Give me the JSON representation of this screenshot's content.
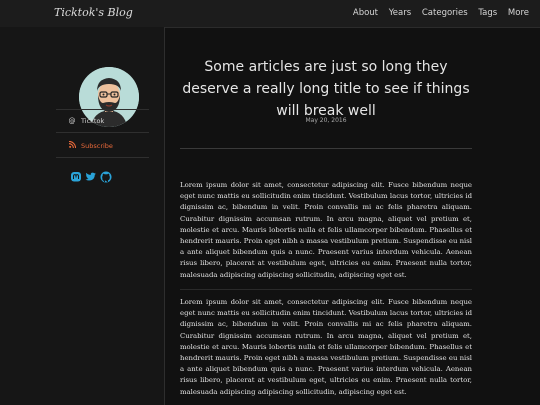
{
  "header": {
    "brand": "Ticktok's Blog",
    "nav": [
      "About",
      "Years",
      "Categories",
      "Tags",
      "More"
    ]
  },
  "sidebar": {
    "avatar_icon": "bearded-man-avatar",
    "ticktok_label": "Ticktok",
    "subscribe_label": "Subscribe",
    "social_icons": [
      "mastodon-icon",
      "twitter-icon",
      "github-icon"
    ],
    "colors": {
      "subscribe": "#e8693a",
      "social": "#2aa3d8"
    }
  },
  "post": {
    "title": "Some articles are just so long they deserve a really long title to see if things will break well",
    "date": "May 20, 2016",
    "paragraphs": [
      "Lorem ipsum dolor sit amet, consectetur adipiscing elit. Fusce bibendum neque eget nunc mattis eu sollicitudin enim tincidunt. Vestibulum lacus tortor, ultricies id dignissim ac, bibendum in velit. Proin convallis mi ac felis pharetra aliquam. Curabitur dignissim accumsan rutrum. In arcu magna, aliquet vel pretium et, molestie et arcu. Mauris lobortis nulla et felis ullamcorper bibendum. Phasellus et hendrerit mauris. Proin eget nibh a massa vestibulum pretium. Suspendisse eu nisl a ante aliquet bibendum quis a nunc. Praesent varius interdum vehicula. Aenean risus libero, placerat at vestibulum eget, ultricies eu enim. Praesent nulla tortor, malesuada adipiscing adipiscing sollicitudin, adipiscing eget est.",
      "Lorem ipsum dolor sit amet, consectetur adipiscing elit. Fusce bibendum neque eget nunc mattis eu sollicitudin enim tincidunt. Vestibulum lacus tortor, ultricies id dignissim ac, bibendum in velit. Proin convallis mi ac felis pharetra aliquam. Curabitur dignissim accumsan rutrum. In arcu magna, aliquet vel pretium et, molestie et arcu. Mauris lobortis nulla et felis ullamcorper bibendum. Phasellus et hendrerit mauris. Proin eget nibh a massa vestibulum pretium. Suspendisse eu nisl a ante aliquet bibendum quis a nunc. Praesent varius interdum vehicula. Aenean risus libero, placerat at vestibulum eget, ultricies eu enim. Praesent nulla tortor, malesuada adipiscing adipiscing sollicitudin, adipiscing eget est."
    ]
  }
}
